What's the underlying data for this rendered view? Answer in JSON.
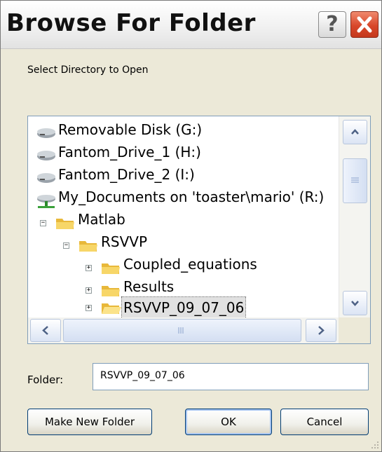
{
  "window": {
    "title": "Browse For Folder",
    "help_glyph": "?"
  },
  "prompt": "Select Directory to Open",
  "tree": [
    {
      "label": "Removable Disk (G:)",
      "icon": "drive-icon"
    },
    {
      "label": "Fantom_Drive_1 (H:)",
      "icon": "drive-icon"
    },
    {
      "label": "Fantom_Drive_2 (I:)",
      "icon": "drive-icon"
    },
    {
      "label": "My_Documents on 'toaster\\mario' (R:)",
      "icon": "network-drive-icon"
    },
    {
      "label": "Matlab",
      "icon": "folder-icon",
      "expander": "⊟"
    },
    {
      "label": "RSVVP",
      "icon": "folder-icon",
      "expander": "⊟"
    },
    {
      "label": "Coupled_equations",
      "icon": "folder-icon",
      "expander": "⊞"
    },
    {
      "label": "Results",
      "icon": "folder-icon",
      "expander": "⊞"
    },
    {
      "label": "RSVVP_09_07_06",
      "icon": "folder-icon",
      "expander": "⊞",
      "selected": true
    }
  ],
  "folder": {
    "label": "Folder:",
    "value": "RSVVP_09_07_06"
  },
  "buttons": {
    "make_new_folder": "Make New Folder",
    "ok": "OK",
    "cancel": "Cancel"
  },
  "colors": {
    "selection": "#e1e1e1",
    "close_red": "#d8472a",
    "border_blue": "#7f9db9"
  }
}
